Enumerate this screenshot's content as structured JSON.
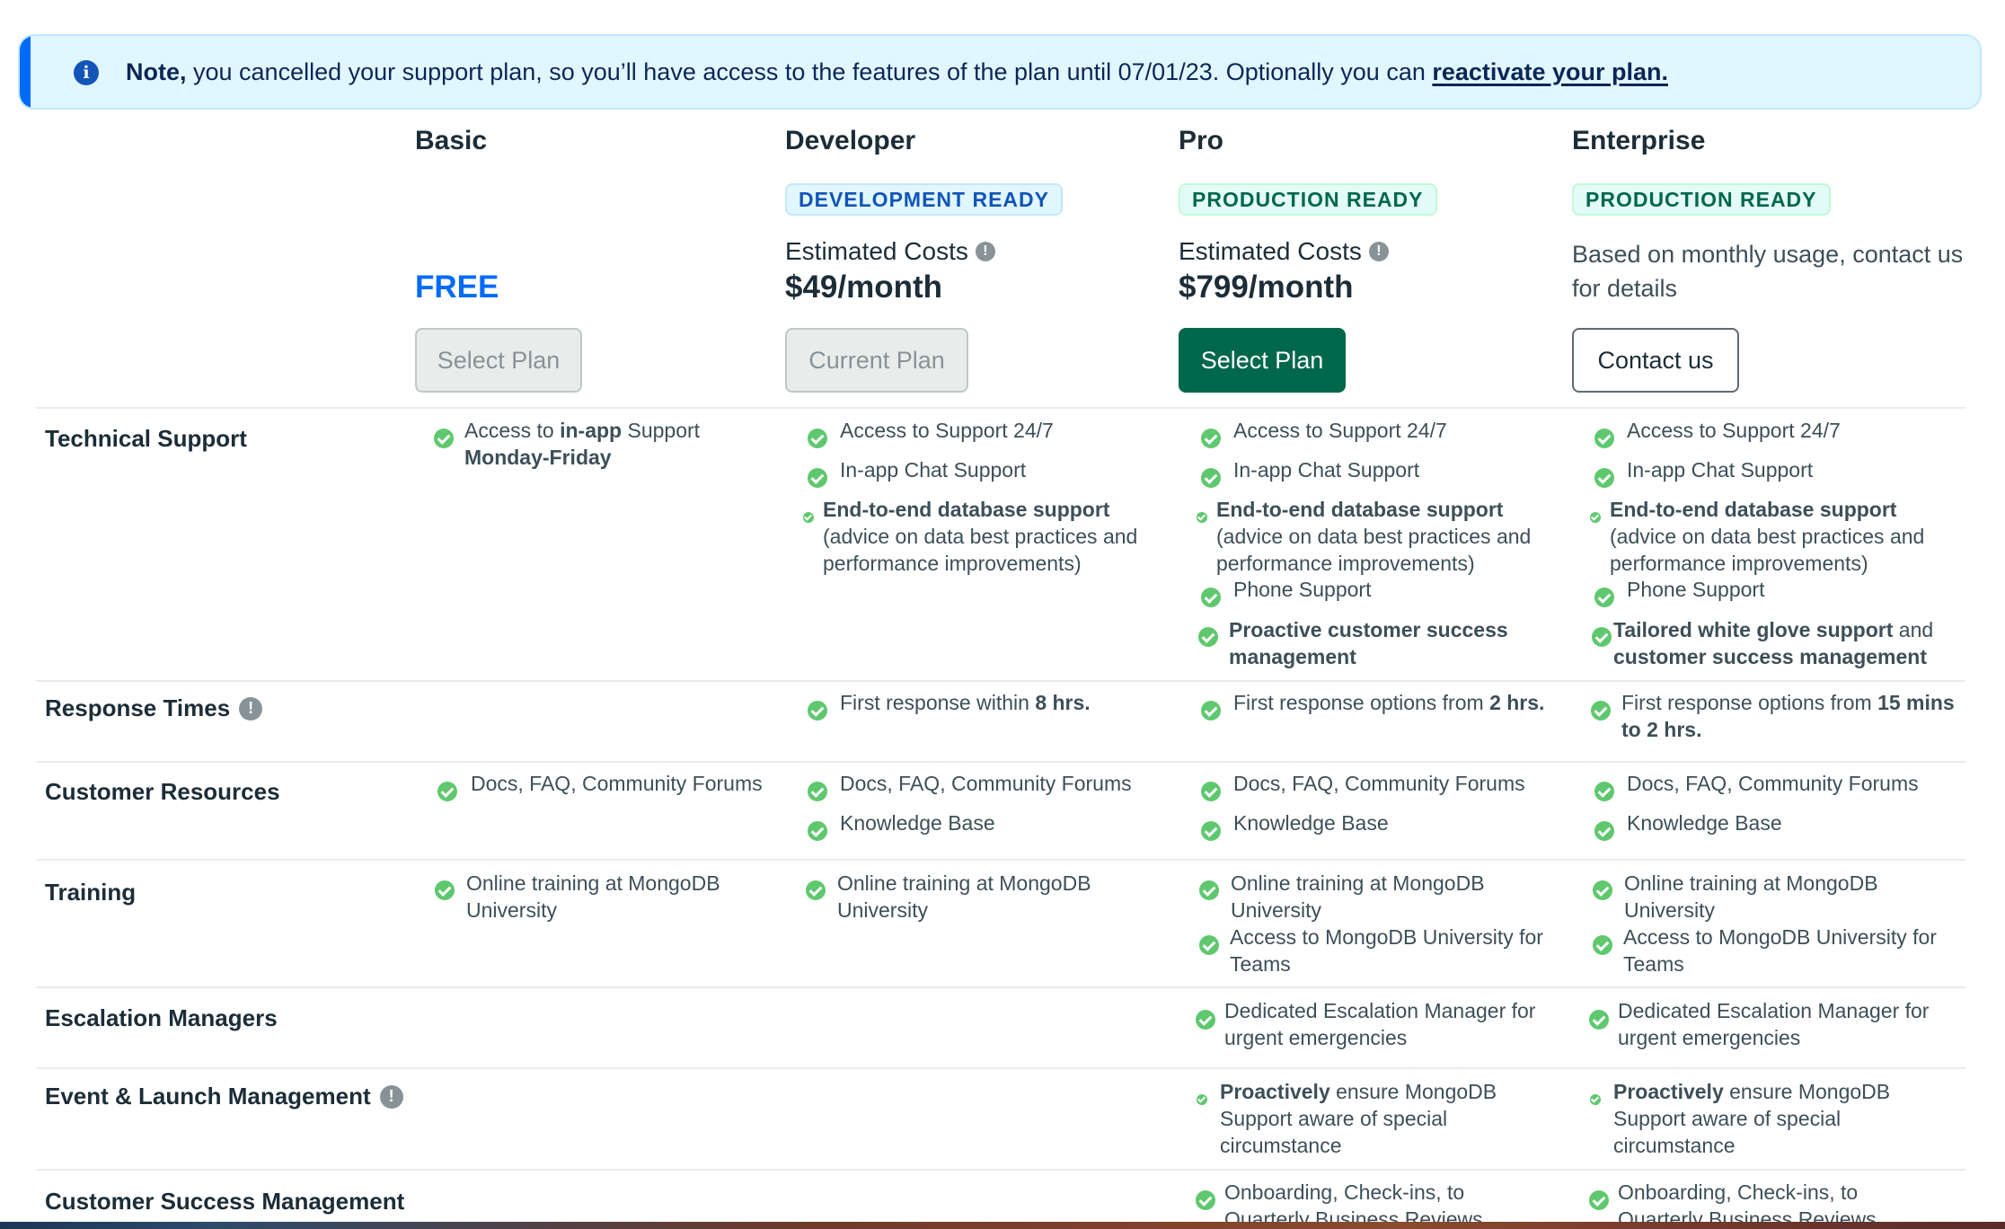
{
  "banner": {
    "bold_prefix": "Note,",
    "text": " you cancelled your support plan, so you’ll have access to the features of the plan until 07/01/23. Optionally you can ",
    "link": "reactivate your plan."
  },
  "plans": {
    "basic": {
      "name": "Basic",
      "price": "FREE",
      "button": "Select Plan"
    },
    "developer": {
      "name": "Developer",
      "badge": "DEVELOPMENT READY",
      "est": "Estimated Costs",
      "price": "$49/month",
      "button": "Current Plan"
    },
    "pro": {
      "name": "Pro",
      "badge": "PRODUCTION READY",
      "est": "Estimated Costs",
      "price": "$799/month",
      "button": "Select Plan"
    },
    "enterprise": {
      "name": "Enterprise",
      "badge": "PRODUCTION READY",
      "usage": "Based on monthly usage, contact us for details",
      "button": "Contact us"
    }
  },
  "rows": {
    "technical_support": "Technical Support",
    "response_times": "Response Times",
    "customer_resources": "Customer Resources",
    "training": "Training",
    "escalation_managers": "Escalation Managers",
    "event_launch": "Event & Launch Management",
    "customer_success": "Customer Success Management"
  },
  "features": {
    "access_to": "Access to ",
    "in_app": "in-app",
    "support": " Support",
    "monday_friday": "Monday-Friday",
    "access_247": "Access to Support 24/7",
    "in_app_chat": "In-app Chat Support",
    "e2e_bold": "End-to-end database support",
    "e2e_rest": "(advice on data best practices and performance improvements)",
    "phone": "Phone Support",
    "proactive_csm_bold": "Proactive customer success management",
    "tailored_bold": "Tailored white glove support",
    "and": " and",
    "csm_bold": "customer success management",
    "first_response_within": "First response within ",
    "eight_hrs": "8 hrs.",
    "first_response_options": "First response options from ",
    "two_hrs": "2 hrs.",
    "fifteen_mins_to": "15 mins",
    "to_two_hrs": "to 2 hrs.",
    "docs": "Docs, FAQ, Community Forums",
    "kb": "Knowledge Base",
    "online_training": "Online training at MongoDB University",
    "teams_training": "Access to MongoDB University for Teams",
    "dedicated_escalation": "Dedicated Escalation Manager for urgent emergencies",
    "proactively_bold": "Proactively",
    "proactively_rest": " ensure MongoDB Support aware of special circumstance",
    "onboarding": "Onboarding, Check-ins, to Quarterly Business Reviews"
  }
}
